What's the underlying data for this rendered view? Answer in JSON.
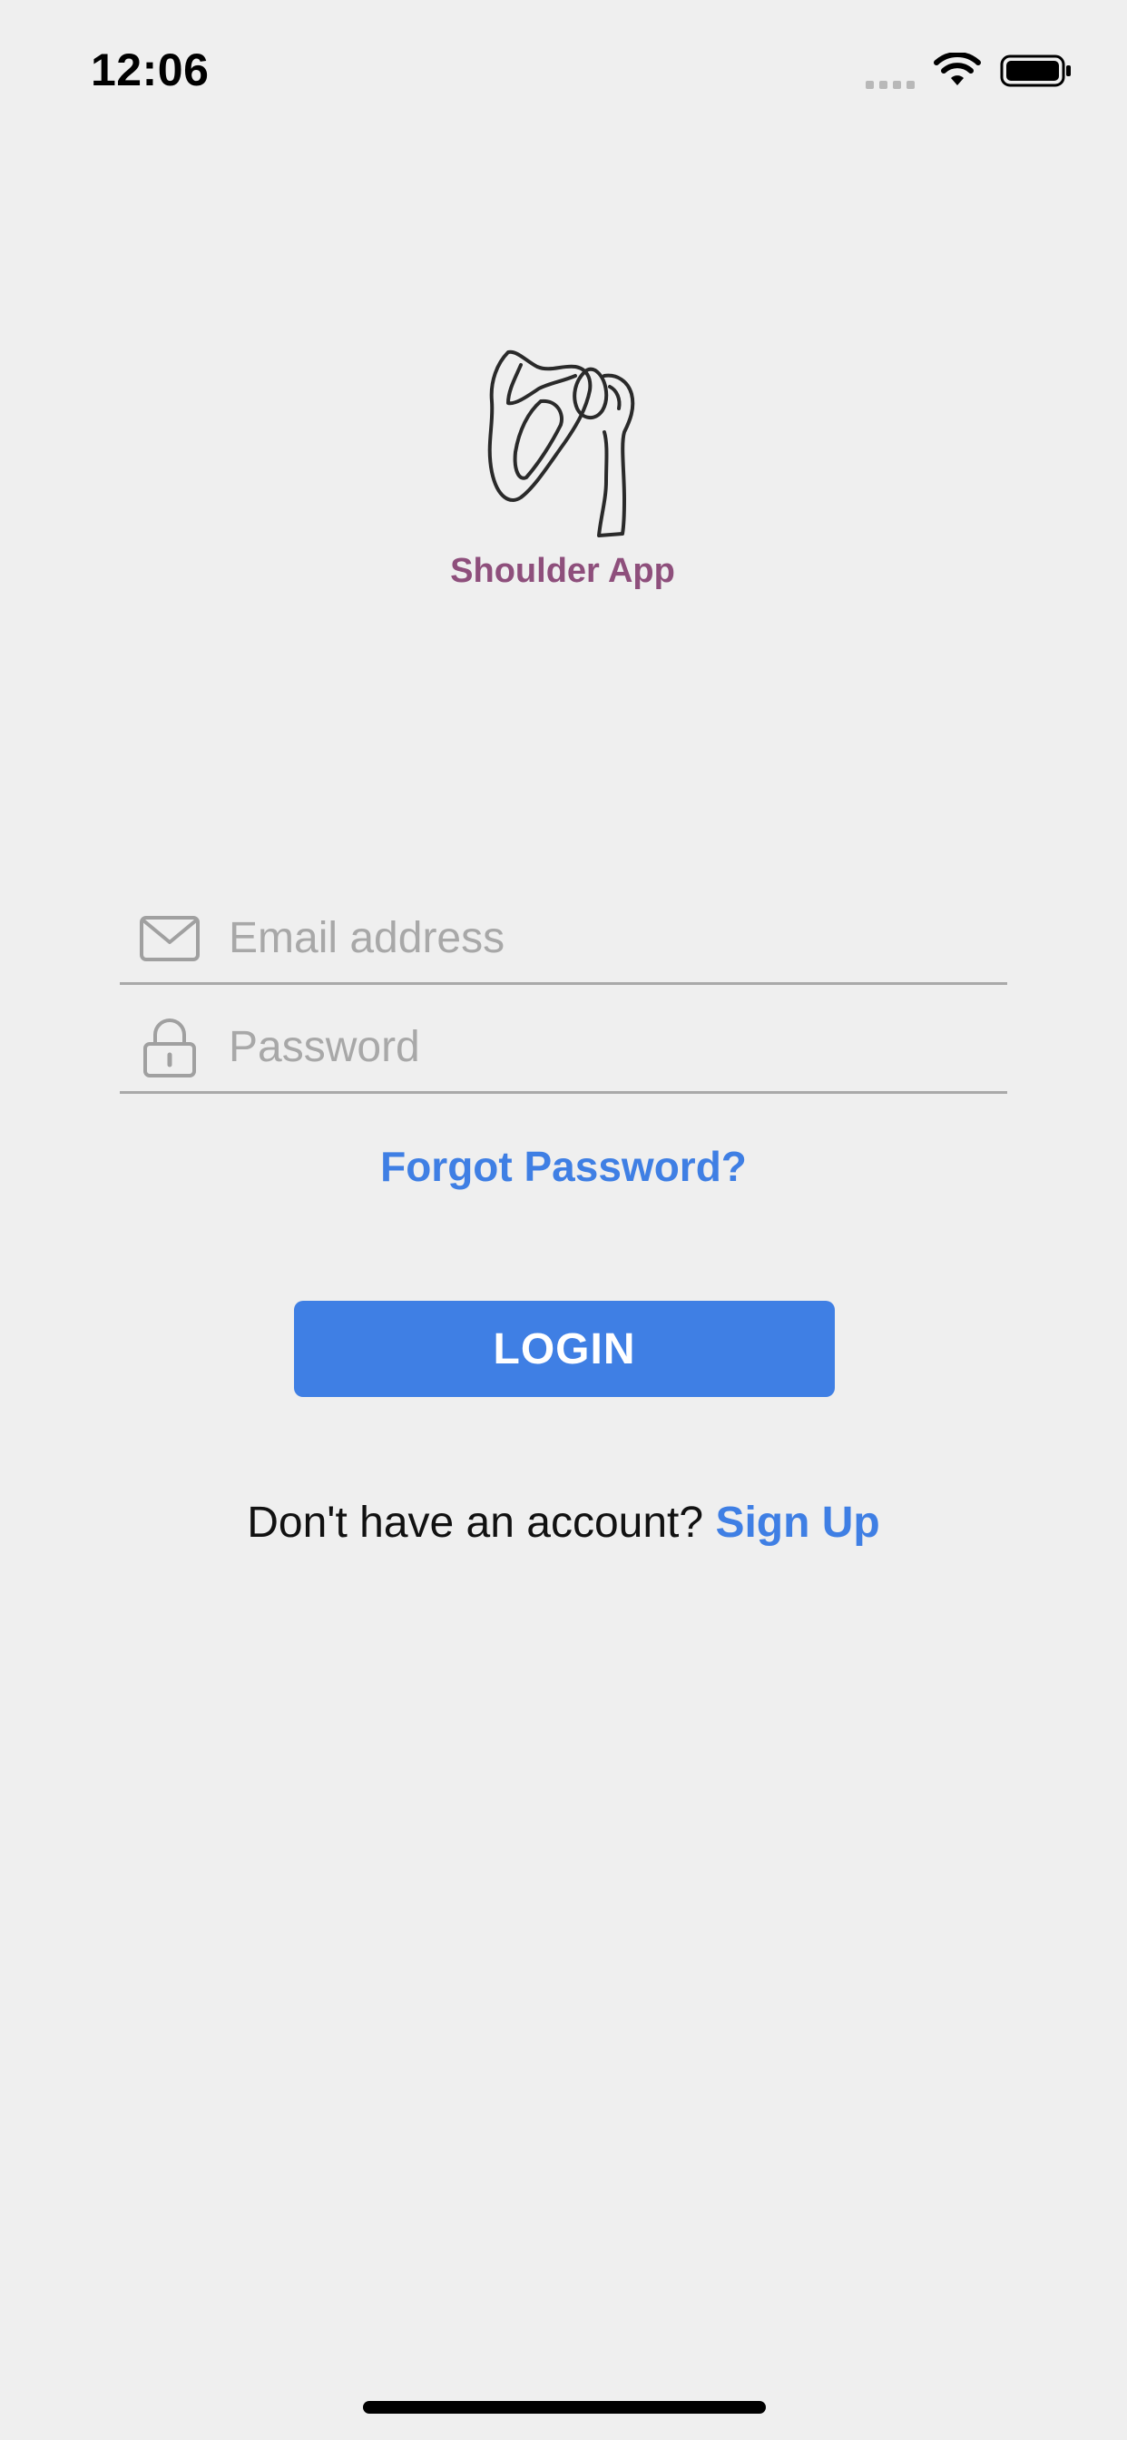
{
  "status_bar": {
    "time": "12:06",
    "icons": [
      "cellular-signal-icon",
      "wifi-icon",
      "battery-icon"
    ]
  },
  "logo": {
    "text": "Shoulder App",
    "icon": "shoulder-bone-icon",
    "text_color": "#8e4f7c"
  },
  "login_form": {
    "email": {
      "placeholder": "Email address",
      "value": "",
      "icon": "envelope-icon"
    },
    "password": {
      "placeholder": "Password",
      "value": "",
      "icon": "lock-icon"
    },
    "forgot_password": "Forgot Password?",
    "login_button": "LOGIN"
  },
  "signup": {
    "prompt": "Don't have an account?",
    "link": "Sign Up"
  },
  "colors": {
    "accent": "#3f7fe4",
    "background": "#efefef"
  }
}
